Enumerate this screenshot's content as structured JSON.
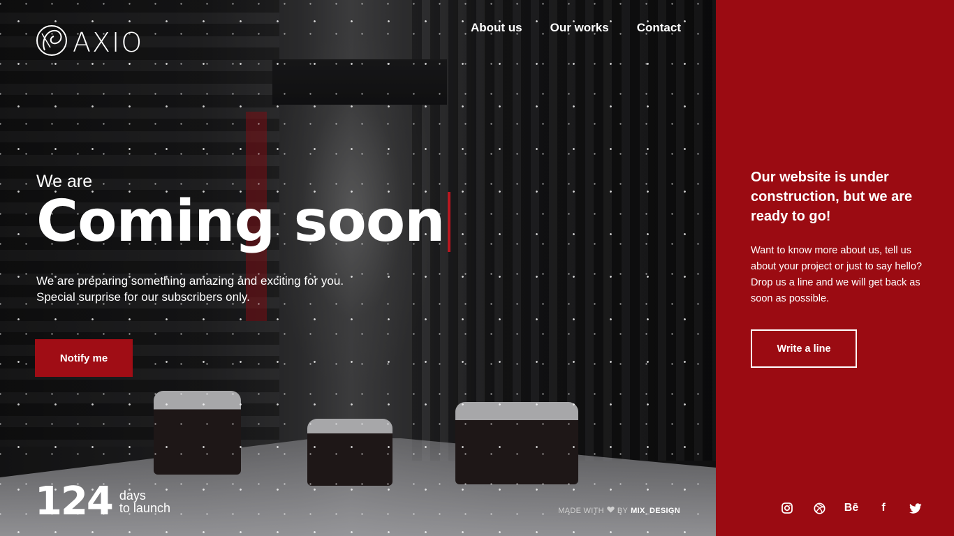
{
  "brand": {
    "name": "AXIO"
  },
  "nav": {
    "about": "About us",
    "works": "Our works",
    "contact": "Contact"
  },
  "hero": {
    "pre_title": "We are",
    "title": "Coming soon",
    "desc_line1": "We are preparing something amazing and exciting for you.",
    "desc_line2": "Special surprise for our subscribers only.",
    "notify_label": "Notify me"
  },
  "countdown": {
    "value": "124",
    "unit": "days",
    "caption": "to launch"
  },
  "credit": {
    "prefix": "MADE WITH",
    "by": "BY",
    "author": "MIX_DESIGN"
  },
  "panel": {
    "heading": "Our website is under construction, but we are ready to go!",
    "body": "Want to know more about us, tell us about your project or just to say hello? Drop us a line and we will get back as soon as possible.",
    "button_label": "Write a line",
    "behance_text": "Bē",
    "facebook_text": "f"
  },
  "colors": {
    "accent": "#9b0b12",
    "button": "#a00d15",
    "caret": "#b81820"
  },
  "icons": [
    "logo-icon",
    "heart-icon",
    "instagram-icon",
    "dribbble-icon",
    "behance-icon",
    "facebook-icon",
    "twitter-icon"
  ]
}
